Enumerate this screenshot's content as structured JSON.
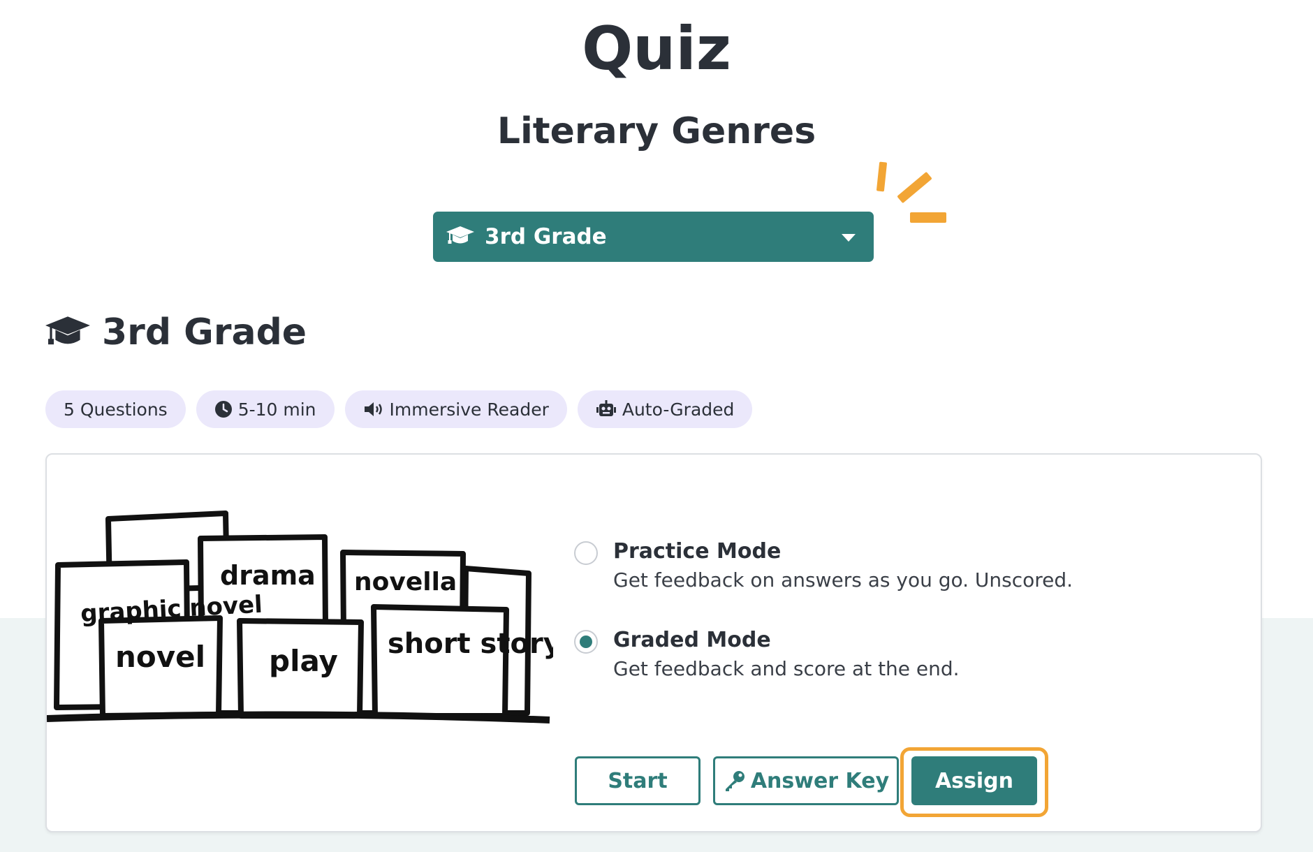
{
  "page": {
    "title": "Quiz",
    "subtitle": "Literary Genres"
  },
  "colors": {
    "primary": "#2f7d7a",
    "highlight": "#f2a535",
    "pill_background": "#ebe8fb",
    "text": "#2b3038"
  },
  "grade_select": {
    "icon": "graduation-cap-icon",
    "value": "3rd Grade",
    "caret_icon": "caret-down-icon"
  },
  "section": {
    "icon": "graduation-cap-icon",
    "heading": "3rd Grade"
  },
  "pills": [
    {
      "icon": "",
      "label": "5 Questions"
    },
    {
      "icon": "clock-icon",
      "label": "5-10 min"
    },
    {
      "icon": "speaker-icon",
      "label": "Immersive Reader"
    },
    {
      "icon": "robot-icon",
      "label": "Auto-Graded"
    }
  ],
  "illustration": {
    "books": [
      "graphic novel",
      "drama",
      "novella",
      "novel",
      "play",
      "short story"
    ]
  },
  "modes": [
    {
      "title": "Practice Mode",
      "description": "Get feedback on answers as you go. Unscored.",
      "selected": false
    },
    {
      "title": "Graded Mode",
      "description": "Get feedback and score at the end.",
      "selected": true
    }
  ],
  "buttons": {
    "start": "Start",
    "answer_key": "Answer Key",
    "answer_key_icon": "key-icon",
    "assign": "Assign"
  }
}
